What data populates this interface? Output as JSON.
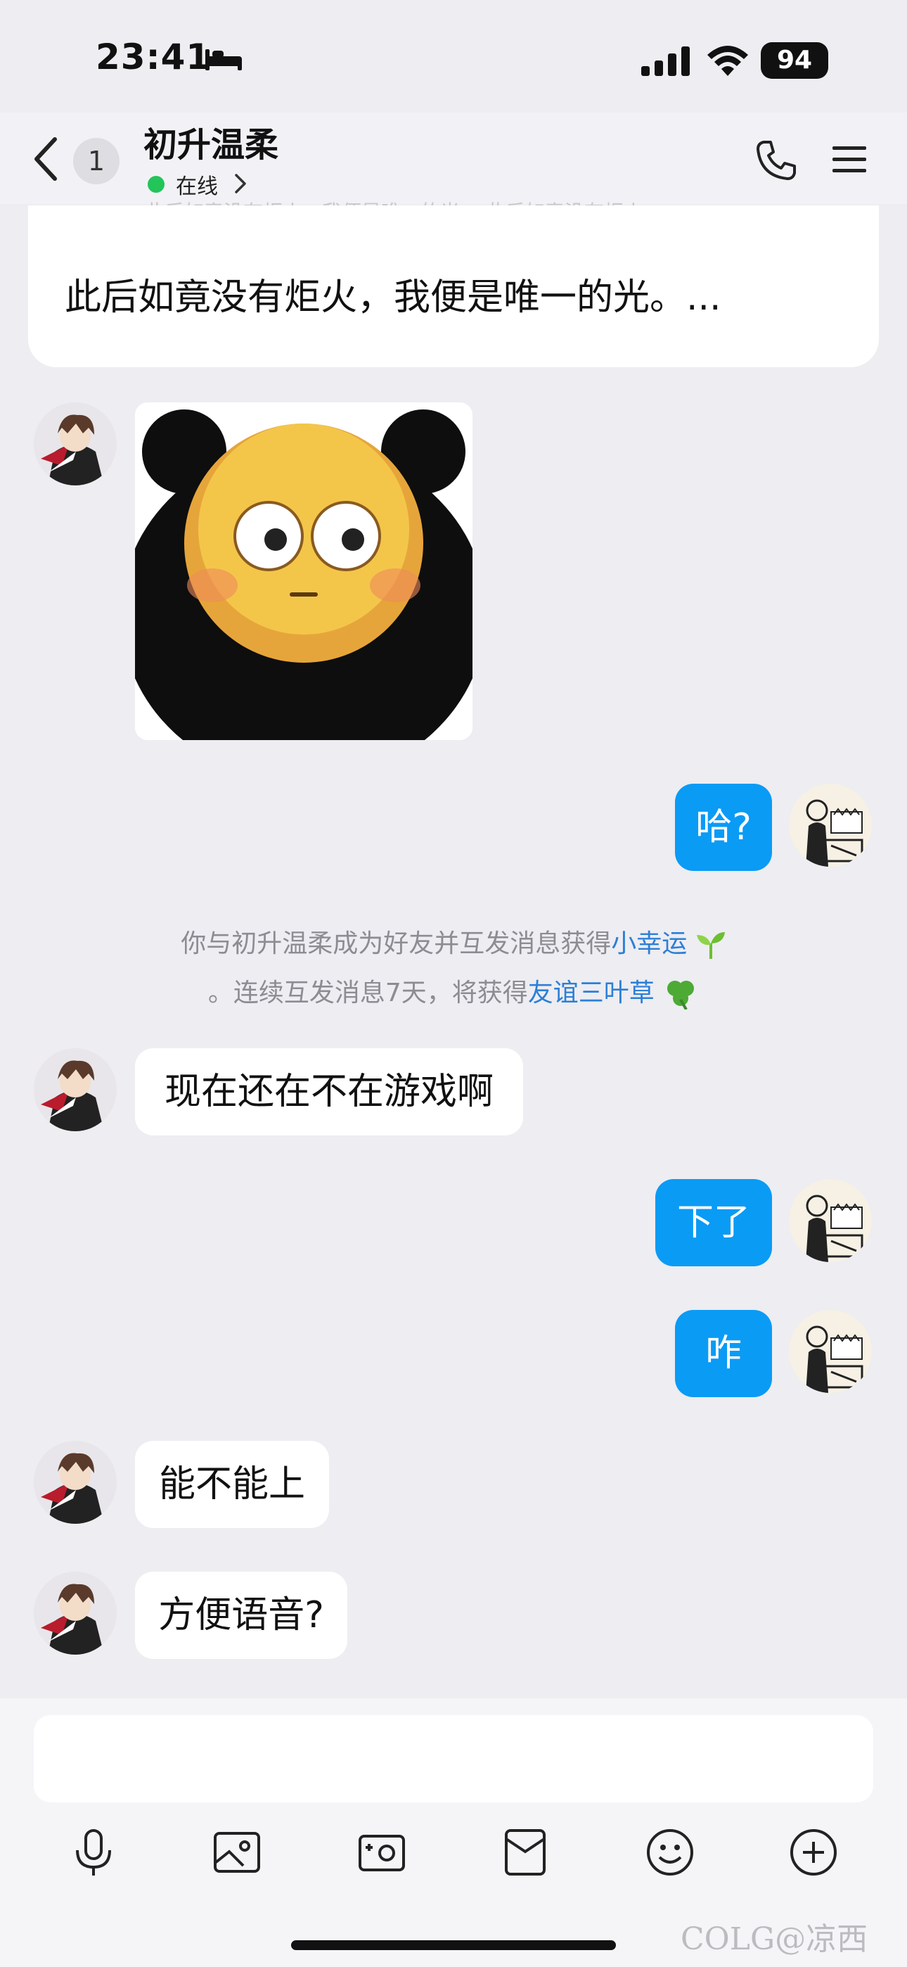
{
  "status_bar": {
    "time": "23:41",
    "battery": "94"
  },
  "header": {
    "title": "初升温柔",
    "status": "在线",
    "unread_count": "1"
  },
  "pinned": {
    "faded_preview": "此后如竟没有炬火，我便是唯一的光。 此后如竟没有炬火...",
    "text": "此后如竟没有炬火，我便是唯一的光。..."
  },
  "messages": {
    "m1": "哈?",
    "m2": "现在还在不在游戏啊",
    "m3": "下了",
    "m4": "咋",
    "m5": "能不能上",
    "m6": "方便语音?"
  },
  "notice": {
    "line1_prefix": "你与初升温柔成为好友并互发消息获得",
    "line1_link": "小幸运",
    "line2_prefix": "。连续互发消息7天，将获得",
    "line2_link": "友谊三叶草"
  },
  "watermark": "COLG@凉西",
  "colors": {
    "outgoing_bubble": "#0a9bf5",
    "online": "#23c45a",
    "link": "#2d7fd6"
  }
}
